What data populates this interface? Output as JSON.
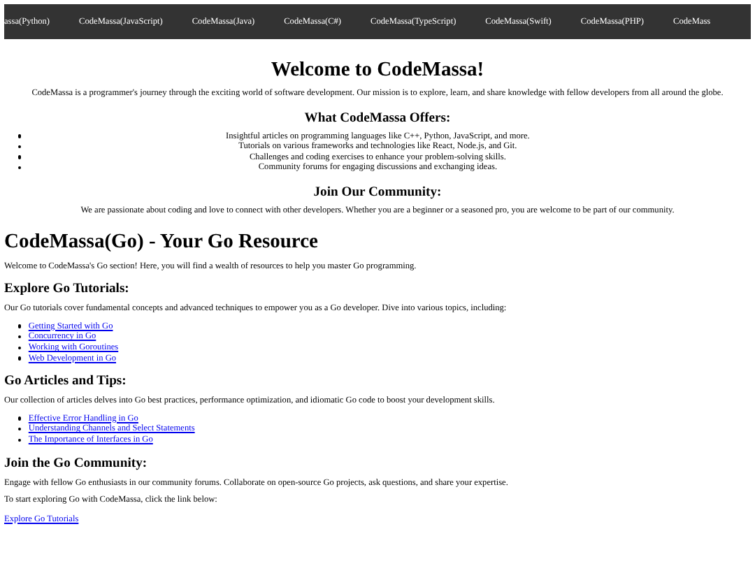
{
  "nav": [
    "assa(Python)",
    "CodeMassa(JavaScript)",
    "CodeMassa(Java)",
    "CodeMassa(C#)",
    "CodeMassa(TypeScript)",
    "CodeMassa(Swift)",
    "CodeMassa(PHP)",
    "CodeMass"
  ],
  "welcome": [
    {
      "kind": "title",
      "text": "Welcome to CodeMassa!"
    },
    {
      "kind": "paragraph",
      "text": "CodeMassa is a programmer's journey through the exciting world of software development. Our mission is to explore, learn, and share knowledge with fellow developers from all around the globe."
    },
    {
      "kind": "heading",
      "text": "What CodeMassa Offers:"
    },
    {
      "kind": "bullets",
      "items": [
        "Insightful articles on programming languages like C++, Python, JavaScript, and more.",
        "Tutorials on various frameworks and technologies like React, Node.js, and Git.",
        "Challenges and coding exercises to enhance your problem-solving skills.",
        "Community forums for engaging discussions and exchanging ideas."
      ]
    },
    {
      "kind": "heading",
      "text": "Join Our Community:"
    },
    {
      "kind": "paragraph",
      "text": "We are passionate about coding and love to connect with other developers. Whether you are a beginner or a seasoned pro, you are welcome to be part of our community."
    }
  ],
  "go_page": [
    {
      "kind": "title",
      "text": "CodeMassa(Go) - Your Go Resource"
    },
    {
      "kind": "paragraph",
      "text": "Welcome to CodeMassa's Go section! Here, you will find a wealth of resources to help you master Go programming."
    },
    {
      "kind": "heading",
      "text": "Explore Go Tutorials:"
    },
    {
      "kind": "paragraph",
      "text": "Our Go tutorials cover fundamental concepts and advanced techniques to empower you as a Go developer. Dive into various topics, including:"
    },
    {
      "kind": "links",
      "items": [
        "Getting Started with Go",
        "Concurrency in Go",
        "Working with Goroutines",
        "Web Development in Go"
      ]
    },
    {
      "kind": "heading",
      "text": "Go Articles and Tips:"
    },
    {
      "kind": "paragraph",
      "text": "Our collection of articles delves into Go best practices, performance optimization, and idiomatic Go code to boost your development skills."
    },
    {
      "kind": "links",
      "items": [
        "Effective Error Handling in Go",
        "Understanding Channels and Select Statements",
        "The Importance of Interfaces in Go"
      ]
    },
    {
      "kind": "heading",
      "text": "Join the Go Community:"
    },
    {
      "kind": "paragraph",
      "text": "Engage with fellow Go enthusiasts in our community forums. Collaborate on open-source Go projects, ask questions, and share your expertise."
    },
    {
      "kind": "paragraph",
      "text": "To start exploring Go with CodeMassa, click the link below:"
    },
    {
      "kind": "link",
      "text": "Explore Go Tutorials"
    }
  ]
}
